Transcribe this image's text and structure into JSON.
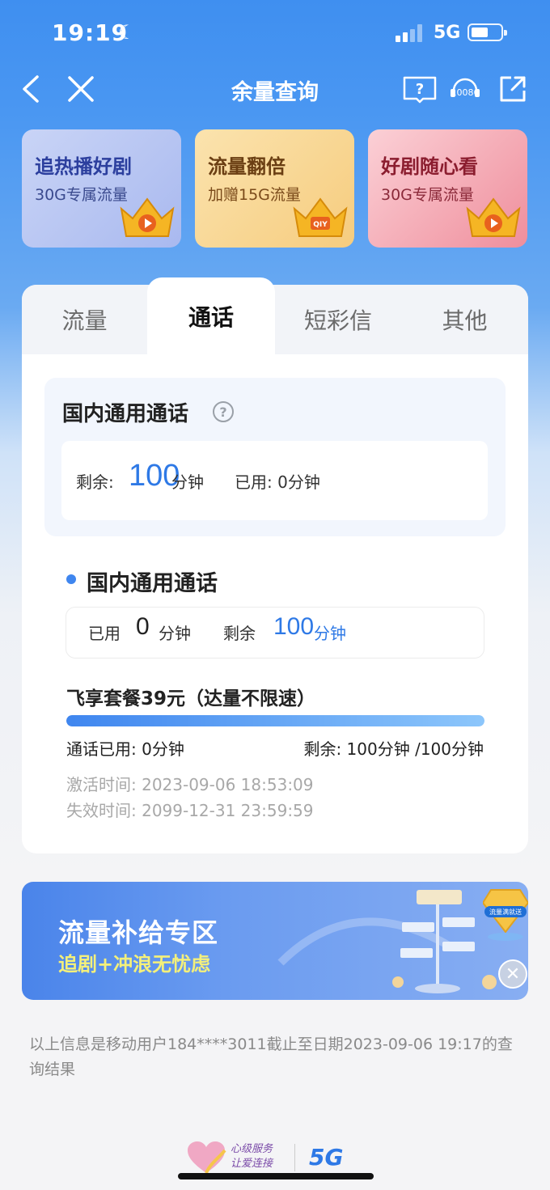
{
  "status": {
    "time": "19:19",
    "network": "5G",
    "colors": {
      "bar": "#4a97f2"
    }
  },
  "nav": {
    "title": "余量查询",
    "service_badge": "10086"
  },
  "promos": [
    {
      "title": "追热播好剧",
      "subtitle": "30G专属流量",
      "icon": "crown-play-icon",
      "color_title": "#2c3f9e"
    },
    {
      "title": "流量翻倍",
      "subtitle": "加赠15G流量",
      "icon": "crown-qiy-icon",
      "color_title": "#6b3f13"
    },
    {
      "title": "好剧随心看",
      "subtitle": "30G专属流量",
      "icon": "crown-play-icon",
      "color_title": "#8b1d2f"
    }
  ],
  "tabs": [
    "流量",
    "通话",
    "短彩信",
    "其他"
  ],
  "active_tab": "通话",
  "summary": {
    "title": "国内通用通话",
    "remain_label": "剩余:",
    "remain_value": "100",
    "remain_unit": "分钟",
    "used_text": "已用: 0分钟"
  },
  "detail": {
    "title": "国内通用通话",
    "used_label": "已用",
    "used_value": "0",
    "used_unit": "分钟",
    "remain_label": "剩余",
    "remain_value": "100",
    "remain_unit": "分钟"
  },
  "plan": {
    "name": "飞享套餐39元（达量不限速）",
    "progress_remaining_fraction": 1.0,
    "used_text": "通话已用: 0分钟",
    "remain_text": "剩余: 100分钟 /100分钟",
    "activation": "激活时间: 2023-09-06 18:53:09",
    "expiry": "失效时间: 2099-12-31 23:59:59"
  },
  "banner": {
    "title": "流量补给专区",
    "subtitle": "追剧+冲浪无忧虑",
    "badge": "流量满就送"
  },
  "footer_note": "以上信息是移动用户184****3011截止至日期2023-09-06 19:17的查询结果",
  "bottom_logo": {
    "line1": "心级服务",
    "line2": "让爱连接",
    "brand": "5G"
  }
}
